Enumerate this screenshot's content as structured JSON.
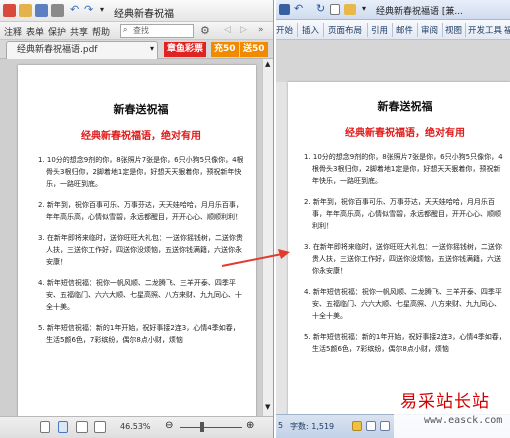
{
  "left_window": {
    "title": "经典新春祝福",
    "menu": [
      "注释",
      "表单",
      "保护",
      "共享",
      "帮助"
    ],
    "search_placeholder": "查找",
    "tab_label": "经典新春祝福语.pdf",
    "promo_label": "章鱼彩票",
    "promo_charge": "充50",
    "promo_gift": "送50",
    "zoom": "46.53%"
  },
  "right_window": {
    "title": "经典新春祝福语 [兼...",
    "ribbon_tabs": [
      "开始",
      "插入",
      "页面布局",
      "引用",
      "邮件",
      "审阅",
      "视图",
      "开发工具",
      "福"
    ],
    "status_page": "5",
    "status_words": "字数: 1,519"
  },
  "document": {
    "title": "新春送祝福",
    "subtitle": "经典新春祝福语，绝对有用",
    "blessings": [
      "1. 10分的想念9剂的你，8张照片7张是你，6只小狗5只像你，4根骨头3根归你，2脚着地1定是你，好想天天狠着你，预祝新年快乐，一路旺到底。",
      "2. 新年到，祝你百事可乐、万事芬达，天天娃哈哈，月月乐百事，年年高乐高，心情似雪碧，永远都醒目，开开心心、顺顺利利！",
      "3. 在新年即将来临时，送你旺旺大礼包：一送你摇钱树，二送你贵人扶，三送你工作好，四送你没烦恼，五送你钱满籍，六送你永安康！",
      "4. 新年短信祝福：祝你一帆风顺、二龙腾飞、三羊开泰、四季平安、五福临门、六六大顺、七星高照、八方来财、九九同心、十全十美。",
      "5. 新年短信祝福：新的1年开始，祝好事接2连3，心情4季如春，生活5颜6色，7彩缤纷，偶尔8点小财，烦恼"
    ]
  },
  "watermark": {
    "site": "易采站长站",
    "url": "www.easck.com"
  },
  "colors": {
    "accent_red": "#e01b1b",
    "promo_red": "#e02222",
    "promo_orange": "#f08a00",
    "word_blue": "#1f3b66"
  }
}
